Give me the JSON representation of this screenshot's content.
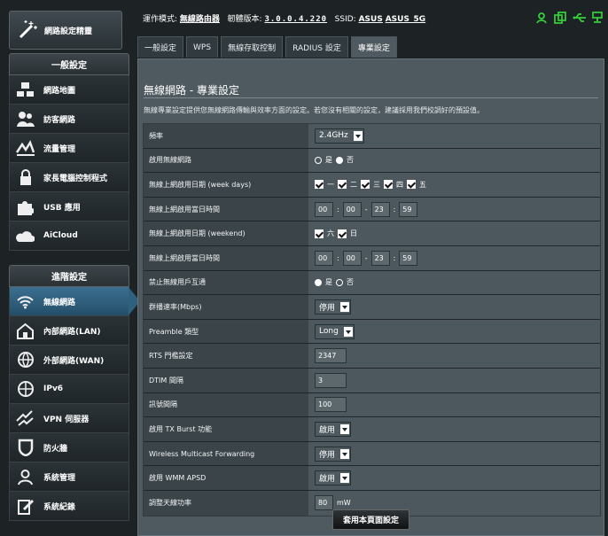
{
  "wizard": {
    "label": "網路設定精靈"
  },
  "topbar": {
    "mode_label": "運作模式:",
    "mode_value": "無線路由器",
    "firmware_label": "韌體版本:",
    "firmware_value": "3.0.0.4.220",
    "ssid_label": "SSID:",
    "ssid_1": "ASUS",
    "ssid_2": "ASUS_5G"
  },
  "tabs": [
    {
      "label": "一般設定"
    },
    {
      "label": "WPS"
    },
    {
      "label": "無線存取控制"
    },
    {
      "label": "RADIUS 設定"
    },
    {
      "label": "專業設定"
    }
  ],
  "sidebar": {
    "general_header": "一般設定",
    "advanced_header": "進階設定",
    "items": [
      {
        "label": "網路地圖"
      },
      {
        "label": "訪客網路"
      },
      {
        "label": "流量管理"
      },
      {
        "label": "家長電腦控制程式"
      },
      {
        "label": "USB 應用"
      },
      {
        "label": "AiCloud"
      },
      {
        "label": "無線網路"
      },
      {
        "label": "內部網路(LAN)"
      },
      {
        "label": "外部網路(WAN)"
      },
      {
        "label": "IPv6"
      },
      {
        "label": "VPN 伺服器"
      },
      {
        "label": "防火牆"
      },
      {
        "label": "系統管理"
      },
      {
        "label": "系統紀錄"
      }
    ]
  },
  "main": {
    "title": "無線網路 - 專業設定",
    "description": "無線專業設定提供您無線網路傳輸與效率方面的設定。若您沒有相關的設定，建議採用我們校調好的預設值。",
    "rows": [
      {
        "label": "頻率",
        "value": "2.4GHz"
      },
      {
        "label": "啟用無線網路",
        "yes": "是",
        "no": "否"
      },
      {
        "label": "無線上網啟用日期 (week days)",
        "days": [
          "一",
          "二",
          "三",
          "四",
          "五"
        ]
      },
      {
        "label": "無線上網啟用當日時間",
        "start_h": "00",
        "start_m": "00",
        "end_h": "23",
        "end_m": "59"
      },
      {
        "label": "無線上網啟用日期 (weekend)",
        "days": [
          "六",
          "日"
        ]
      },
      {
        "label": "無線上網啟用當日時間",
        "start_h": "00",
        "start_m": "00",
        "end_h": "23",
        "end_m": "59"
      },
      {
        "label": "禁止無線用戶互通",
        "yes": "是",
        "no": "否"
      },
      {
        "label": "群播速率(Mbps)",
        "value": "停用"
      },
      {
        "label": "Preamble 類型",
        "value": "Long"
      },
      {
        "label": "RTS 門檻設定",
        "value": "2347"
      },
      {
        "label": "DTIM 間隔",
        "value": "3"
      },
      {
        "label": "訊號間隔",
        "value": "100"
      },
      {
        "label": "啟用 TX Burst 功能",
        "value": "啟用"
      },
      {
        "label": "Wireless Multicast Forwarding",
        "value": "停用"
      },
      {
        "label": "啟用 WMM APSD",
        "value": "啟用"
      },
      {
        "label": "調整天線功率",
        "value": "80",
        "unit": "mW"
      }
    ],
    "apply_button": "套用本頁面設定"
  },
  "colors": {
    "accent": "#2f607e",
    "panel": "#4f5a60",
    "status_green": "#2fd23b"
  }
}
